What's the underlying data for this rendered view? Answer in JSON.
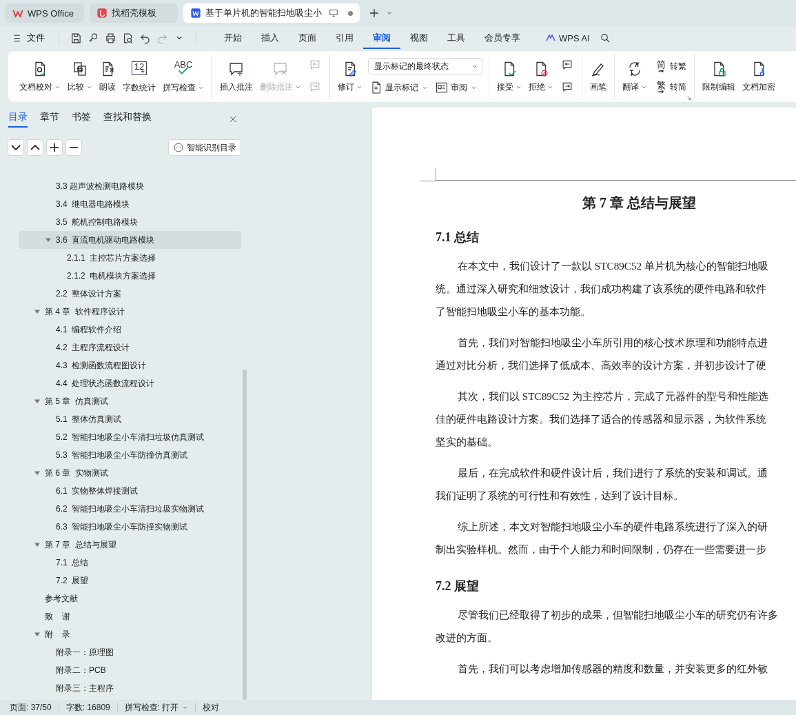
{
  "title_tabs": [
    {
      "kind": "home",
      "label": "WPS Office",
      "selected": false
    },
    {
      "kind": "template",
      "label": "找稻壳模板",
      "selected": false
    },
    {
      "kind": "document",
      "label": "基于单片机的智能扫地吸尘小",
      "selected": true,
      "unsaved": true
    }
  ],
  "menu": {
    "file_label": "文件",
    "quick_access": [
      {
        "kind": "save",
        "disabled": false
      },
      {
        "kind": "key",
        "disabled": false
      },
      {
        "kind": "print",
        "disabled": false
      },
      {
        "kind": "preview",
        "disabled": false
      },
      {
        "kind": "undo",
        "disabled": false
      },
      {
        "kind": "redo",
        "disabled": true
      },
      {
        "kind": "more",
        "disabled": false
      }
    ],
    "tabs": [
      {
        "label": "开始",
        "selected": false
      },
      {
        "label": "插入",
        "selected": false
      },
      {
        "label": "页面",
        "selected": false
      },
      {
        "label": "引用",
        "selected": false
      },
      {
        "label": "审阅",
        "selected": true
      },
      {
        "label": "视图",
        "selected": false
      },
      {
        "label": "工具",
        "selected": false
      },
      {
        "label": "会员专享",
        "selected": false
      }
    ],
    "ai_label": "WPS AI"
  },
  "ribbon": [
    {
      "items": [
        {
          "kind": "large",
          "label": "文档校对",
          "dropdown": true,
          "disabled": false
        },
        {
          "kind": "large",
          "label": "比较",
          "dropdown": true,
          "disabled": false
        },
        {
          "kind": "large",
          "label": "朗读",
          "dropdown": false,
          "disabled": false
        },
        {
          "kind": "large",
          "label": "字数统计",
          "dropdown": false,
          "disabled": false,
          "icon_text": "12"
        },
        {
          "kind": "large",
          "label": "拼写检查",
          "dropdown": true,
          "disabled": false,
          "icon_text": "ABC"
        }
      ]
    },
    {
      "items": [
        {
          "kind": "large",
          "label": "插入批注",
          "dropdown": false,
          "disabled": false
        },
        {
          "kind": "large",
          "label": "删除批注",
          "dropdown": true,
          "disabled": true
        },
        {
          "kind": "stack",
          "rows": [
            [
              {
                "kind": "icon",
                "disabled": true
              }
            ],
            [
              {
                "kind": "icon",
                "disabled": true
              }
            ]
          ]
        }
      ]
    },
    {
      "items": [
        {
          "kind": "large",
          "label": "修订",
          "dropdown": true,
          "disabled": false
        },
        {
          "kind": "stack",
          "rows": [
            [
              {
                "kind": "select",
                "value": "显示标记的最终状态"
              }
            ],
            [
              {
                "kind": "small",
                "label": "显示标记",
                "dropdown": true,
                "disabled": false
              },
              {
                "kind": "small",
                "label": "审阅",
                "dropdown": true,
                "disabled": false
              }
            ]
          ]
        }
      ]
    },
    {
      "items": [
        {
          "kind": "large",
          "label": "接受",
          "dropdown": true,
          "disabled": false
        },
        {
          "kind": "large",
          "label": "拒绝",
          "dropdown": true,
          "disabled": false
        },
        {
          "kind": "stack",
          "rows": [
            [
              {
                "kind": "icon",
                "disabled": false
              }
            ],
            [
              {
                "kind": "icon",
                "disabled": false
              }
            ]
          ]
        }
      ]
    },
    {
      "items": [
        {
          "kind": "large",
          "label": "画笔",
          "dropdown": false,
          "disabled": false
        }
      ]
    },
    {
      "items": [
        {
          "kind": "large",
          "label": "翻译",
          "dropdown": true,
          "disabled": false
        },
        {
          "kind": "stack",
          "rows": [
            [
              {
                "kind": "small",
                "label": "转繁",
                "dropdown": false,
                "disabled": false,
                "icon_text": "简"
              }
            ],
            [
              {
                "kind": "small",
                "label": "转简",
                "dropdown": false,
                "disabled": false,
                "icon_text": "繁"
              }
            ]
          ]
        }
      ]
    },
    {
      "items": [
        {
          "kind": "large",
          "label": "限制编辑",
          "dropdown": false,
          "disabled": false
        },
        {
          "kind": "large",
          "label": "文档加密",
          "dropdown": false,
          "disabled": false
        }
      ]
    }
  ],
  "nav_panel": {
    "tabs": [
      {
        "label": "目录",
        "selected": true
      },
      {
        "label": "章节",
        "selected": false
      },
      {
        "label": "书签",
        "selected": false
      },
      {
        "label": "查找和替换",
        "selected": false
      }
    ],
    "tool_buttons": [
      {
        "kind": "down"
      },
      {
        "kind": "up"
      },
      {
        "kind": "expand"
      },
      {
        "kind": "collapse"
      }
    ],
    "smart_button": "智能识别目录",
    "toc": {
      "continued": [
        {
          "label": "3.3 超声波检测电路模块",
          "selected": false
        },
        {
          "label": "3.4  继电器电路模块",
          "selected": false
        },
        {
          "label": "3.5  舵机控制电路模块",
          "selected": false
        },
        {
          "label": "3.6  直流电机驱动电路模块",
          "selected": true,
          "expanded": true,
          "children": [
            {
              "label": "2.1.1  主控芯片方案选择",
              "selected": false
            },
            {
              "label": "2.1.2  电机模块方案选择",
              "selected": false
            }
          ]
        },
        {
          "label": "2.2  整体设计方案",
          "selected": false
        }
      ],
      "items": [
        {
          "label": "第 4 章  软件程序设计",
          "selected": false,
          "expanded": true,
          "children": [
            {
              "label": "4.1  编程软件介绍",
              "selected": false
            },
            {
              "label": "4.2  主程序流程设计",
              "selected": false
            },
            {
              "label": "4.3  检测函数流程图设计",
              "selected": false
            },
            {
              "label": "4.4  处理状态函数流程设计",
              "selected": false
            }
          ]
        },
        {
          "label": "第 5 章  仿真测试",
          "selected": false,
          "expanded": true,
          "children": [
            {
              "label": "5.1  整体仿真测试",
              "selected": false
            },
            {
              "label": "5.2  智能扫地吸尘小车清扫垃圾仿真测试",
              "selected": false
            },
            {
              "label": "5.3  智能扫地吸尘小车防撞仿真测试",
              "selected": false
            }
          ]
        },
        {
          "label": "第 6 章  实物测试",
          "selected": false,
          "expanded": true,
          "children": [
            {
              "label": "6.1  实物整体焊接测试",
              "selected": false
            },
            {
              "label": "6.2  智能扫地吸尘小车清扫垃圾实物测试",
              "selected": false
            },
            {
              "label": "6.3  智能扫地吸尘小车防撞实物测试",
              "selected": false
            }
          ]
        },
        {
          "label": "第 7 章  总结与展望",
          "selected": false,
          "expanded": true,
          "children": [
            {
              "label": "7.1  总结",
              "selected": false
            },
            {
              "label": "7.2  展望",
              "selected": false
            }
          ]
        },
        {
          "label": "参考文献",
          "selected": false
        },
        {
          "label": "致    谢",
          "selected": false
        },
        {
          "label": "附    录",
          "selected": false,
          "expanded": true,
          "children": [
            {
              "label": "附录一：原理图",
              "selected": false
            },
            {
              "label": "附录二：PCB",
              "selected": false
            },
            {
              "label": "附录三：主程序",
              "selected": false
            }
          ]
        }
      ]
    }
  },
  "document": {
    "chapter_title": "第 7 章  总结与展望",
    "blocks": [
      {
        "kind": "heading",
        "text": "7.1  总结"
      },
      {
        "kind": "paragraph",
        "lines": [
          "在本文中，我们设计了一款以 STC89C52 单片机为核心的智能扫地吸",
          "统。通过深入研究和细致设计，我们成功构建了该系统的硬件电路和软件",
          "了智能扫地吸尘小车的基本功能。"
        ]
      },
      {
        "kind": "paragraph",
        "lines": [
          "首先，我们对智能扫地吸尘小车所引用的核心技术原理和功能特点进",
          "通过对比分析，我们选择了低成本、高效率的设计方案，并初步设计了硬"
        ]
      },
      {
        "kind": "paragraph",
        "lines": [
          "其次，我们以 STC89C52 为主控芯片，完成了元器件的型号和性能选",
          "佳的硬件电路设计方案。我们选择了适合的传感器和显示器，为软件系统",
          "坚实的基础。"
        ]
      },
      {
        "kind": "paragraph",
        "lines": [
          "最后，在完成软件和硬件设计后，我们进行了系统的安装和调试。通",
          "我们证明了系统的可行性和有效性，达到了设计目标。"
        ]
      },
      {
        "kind": "paragraph",
        "lines": [
          "综上所述，本文对智能扫地吸尘小车的硬件电路系统进行了深入的研",
          "制出实验样机。然而，由于个人能力和时间限制，仍存在一些需要进一步"
        ]
      },
      {
        "kind": "heading",
        "text": "7.2  展望"
      },
      {
        "kind": "paragraph",
        "lines": [
          "尽管我们已经取得了初步的成果，但智能扫地吸尘小车的研究仍有许多",
          "改进的方面。"
        ]
      },
      {
        "kind": "paragraph",
        "lines": [
          "首先，我们可以考虑增加传感器的精度和数量，并安装更多的红外敏"
        ]
      }
    ]
  },
  "status_bar": [
    {
      "label": "页面: 37/50",
      "dropdown": false
    },
    {
      "label": "字数: 16809",
      "dropdown": false
    },
    {
      "label": "拼写检查: 打开",
      "dropdown": true
    },
    {
      "label": "校对",
      "dropdown": false
    }
  ]
}
